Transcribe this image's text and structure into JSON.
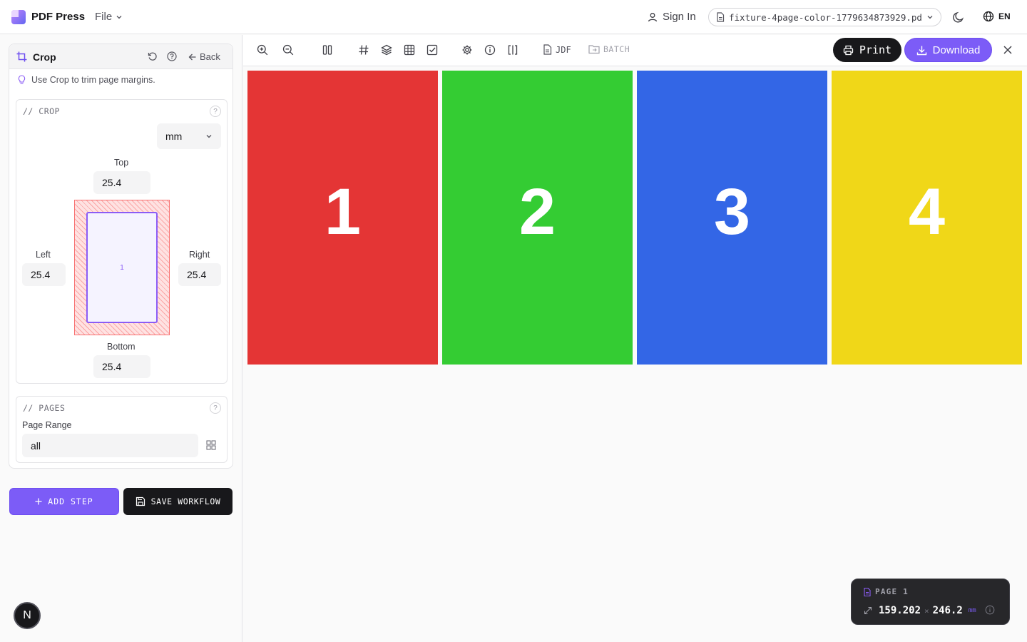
{
  "app": {
    "name": "PDF Press",
    "file_menu": "File"
  },
  "header": {
    "sign_in": "Sign In",
    "filename": "fixture-4page-color-1779634873929.pdf",
    "language": "EN"
  },
  "tool": {
    "title": "Crop",
    "back": "Back",
    "tip": "Use Crop to trim page margins."
  },
  "crop": {
    "section_label": "// CROP",
    "unit": "mm",
    "top_label": "Top",
    "top": "25.4",
    "left_label": "Left",
    "left": "25.4",
    "right_label": "Right",
    "right": "25.4",
    "bottom_label": "Bottom",
    "bottom": "25.4",
    "preview_page": "1",
    "help": "?"
  },
  "pages": {
    "section_label": "// PAGES",
    "range_label": "Page Range",
    "range": "all",
    "help": "?"
  },
  "actions": {
    "add_step": "ADD STEP",
    "save_workflow": "SAVE WORKFLOW"
  },
  "toolbar": {
    "jdf": "JDF",
    "batch": "BATCH",
    "print": "Print",
    "download": "Download"
  },
  "page_thumbs": [
    {
      "number": "1",
      "color": "#e43535"
    },
    {
      "number": "2",
      "color": "#34cc33"
    },
    {
      "number": "3",
      "color": "#3366e6"
    },
    {
      "number": "4",
      "color": "#f0d718"
    }
  ],
  "page_info": {
    "label": "PAGE 1",
    "width": "159.202",
    "separator": "×",
    "height": "246.2",
    "unit": "mm"
  },
  "badge": "N"
}
